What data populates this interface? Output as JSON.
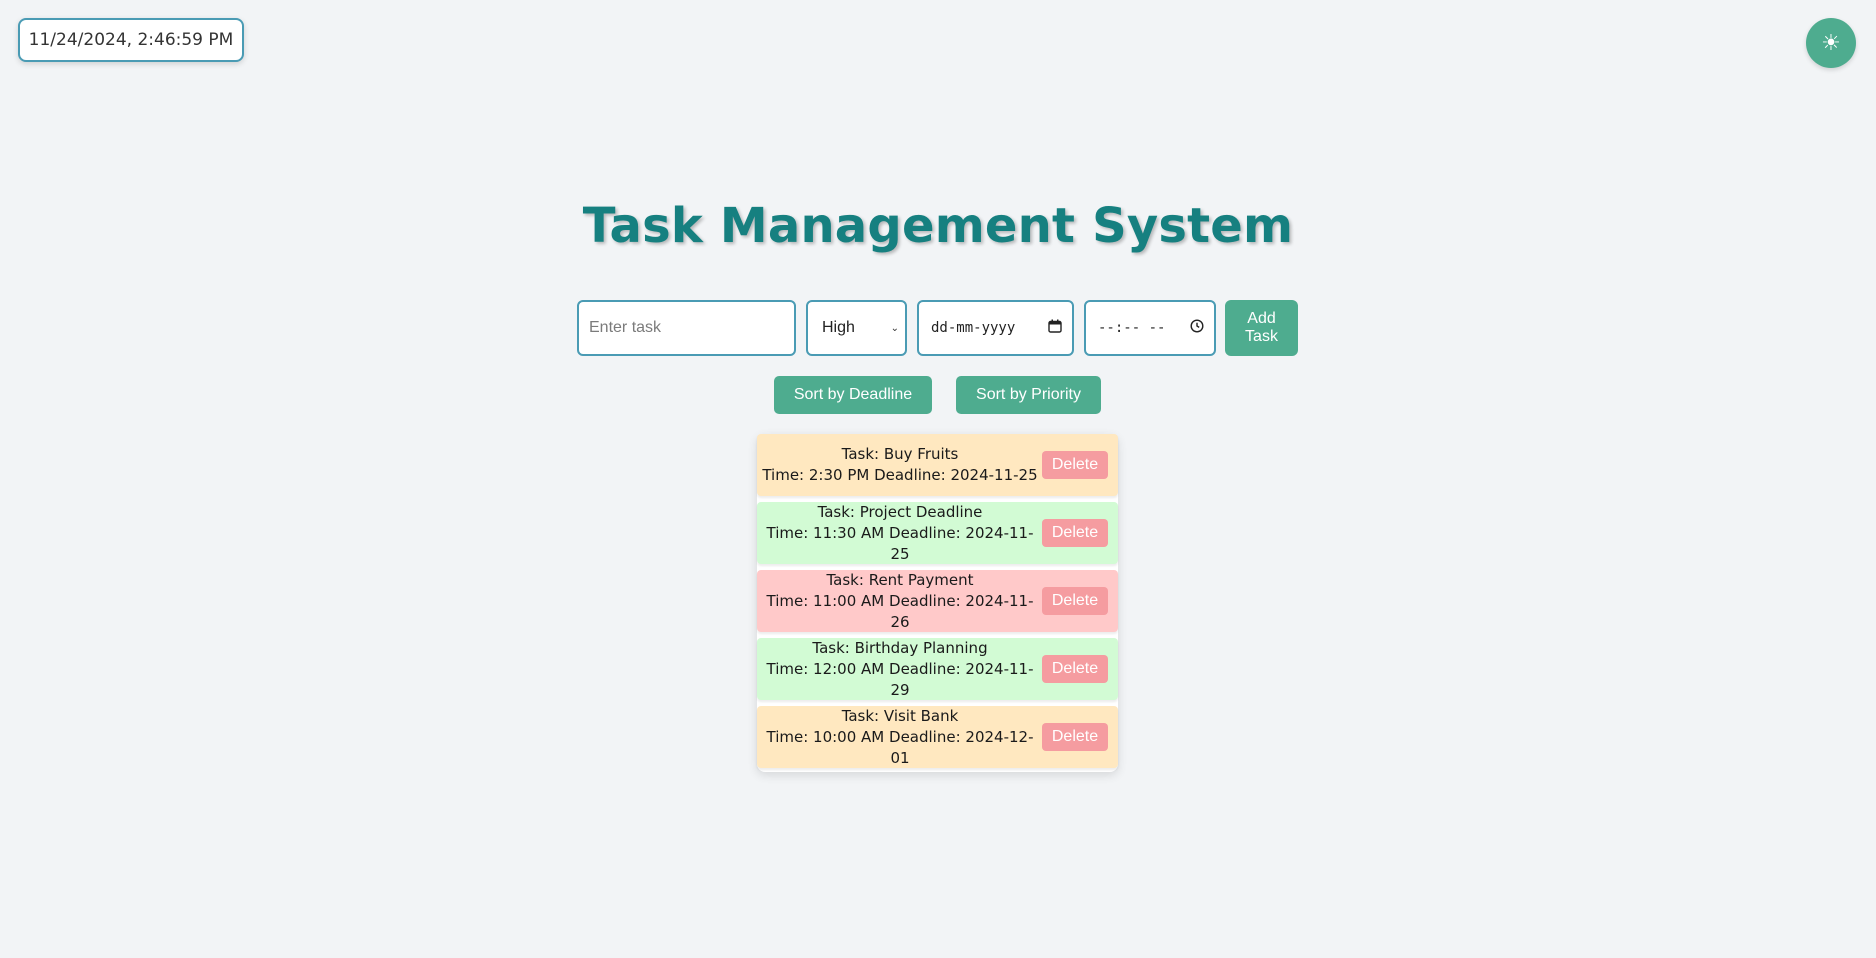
{
  "clock": {
    "text": "11/24/2024, 2:46:59 PM"
  },
  "theme_toggle": {
    "icon": "sun-icon",
    "glyph": "☀"
  },
  "title": "Task Management System",
  "form": {
    "task_placeholder": "Enter task",
    "priority_selected": "High",
    "date_placeholder": "dd-mm-yyyy",
    "time_placeholder": "--:-- --",
    "add_label_line1": "Add",
    "add_label_line2": "Task"
  },
  "sort": {
    "deadline_label": "Sort by Deadline",
    "priority_label": "Sort by Priority"
  },
  "colors": {
    "accent": "#4eac8f",
    "title": "#168080",
    "border": "#4a9bb4",
    "delete": "#f59ca0",
    "medium": "#ffe8c0",
    "low": "#d2fbd4",
    "high": "#ffc9c9"
  },
  "tasks": [
    {
      "line1": "Task: Buy Fruits",
      "line2": "Time: 2:30 PM Deadline: 2024-11-25",
      "delete_label": "Delete",
      "color": "#ffe8c0"
    },
    {
      "line1": "Task: Project Deadline",
      "line2": "Time: 11:30 AM Deadline: 2024-11-25",
      "delete_label": "Delete",
      "color": "#d2fbd4"
    },
    {
      "line1": "Task: Rent Payment",
      "line2": "Time: 11:00 AM Deadline: 2024-11-26",
      "delete_label": "Delete",
      "color": "#ffc9c9"
    },
    {
      "line1": "Task: Birthday Planning",
      "line2": "Time: 12:00 AM Deadline: 2024-11-29",
      "delete_label": "Delete",
      "color": "#d2fbd4"
    },
    {
      "line1": "Task: Visit Bank",
      "line2": "Time: 10:00 AM Deadline: 2024-12-01",
      "delete_label": "Delete",
      "color": "#ffe8c0"
    }
  ]
}
